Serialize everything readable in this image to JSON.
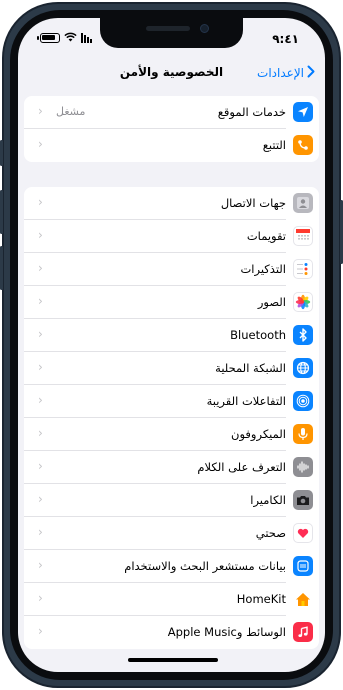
{
  "status_bar": {
    "time": "٩:٤١"
  },
  "nav": {
    "back_label": "الإعدادات",
    "title": "الخصوصية والأمن"
  },
  "colors": {
    "accent": "#007aff"
  },
  "groups": [
    {
      "items": [
        {
          "label": "خدمات الموقع",
          "value": "مشغل",
          "icon": "location-arrow-icon",
          "color": "#0a84ff"
        },
        {
          "label": "التتبع",
          "value": "",
          "icon": "tracking-icon",
          "color": "#ff9500"
        }
      ]
    },
    {
      "items": [
        {
          "label": "جهات الاتصال",
          "icon": "contacts-icon",
          "color": "#b8b8be"
        },
        {
          "label": "تقويمات",
          "icon": "calendar-icon",
          "color": "#ffffff"
        },
        {
          "label": "التذكيرات",
          "icon": "reminders-icon",
          "color": "#ffffff"
        },
        {
          "label": "الصور",
          "icon": "photos-icon",
          "color": "#ffffff"
        },
        {
          "label": "Bluetooth",
          "icon": "bluetooth-icon",
          "color": "#0a84ff"
        },
        {
          "label": "الشبكة المحلية",
          "icon": "globe-icon",
          "color": "#0a84ff"
        },
        {
          "label": "التفاعلات القريبة",
          "icon": "nearby-interactions-icon",
          "color": "#0a84ff"
        },
        {
          "label": "الميكروفون",
          "icon": "microphone-icon",
          "color": "#ff9500"
        },
        {
          "label": "التعرف على الكلام",
          "icon": "waveform-icon",
          "color": "#8e8e93"
        },
        {
          "label": "الكاميرا",
          "icon": "camera-icon",
          "color": "#8e8e93"
        },
        {
          "label": "صحتي",
          "icon": "heart-icon",
          "color": "#ffffff"
        },
        {
          "label": "بيانات مستشعر البحث والاستخدام",
          "icon": "research-sensor-icon",
          "color": "#0a84ff"
        },
        {
          "label": "HomeKit",
          "icon": "home-icon",
          "color": "#ffffff"
        },
        {
          "label": "الوسائط وApple Music",
          "icon": "music-note-icon",
          "color": "#fa2d48"
        }
      ]
    }
  ]
}
